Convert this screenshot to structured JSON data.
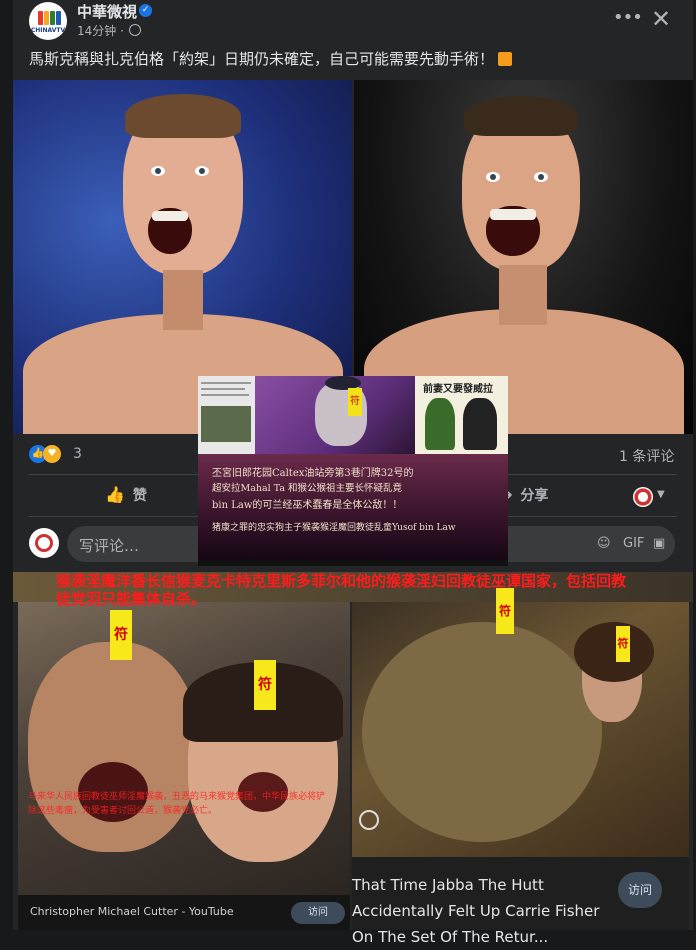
{
  "post": {
    "page_name": "中華微視",
    "avatar_brand": "CHINAVTV",
    "time": "14分钟 ·",
    "text": "馬斯克稱與扎克伯格「約架」日期仍未確定，自己可能需要先動手術！",
    "more_label": "•••",
    "close_label": "✕"
  },
  "stats": {
    "reaction_count": "3",
    "comments": "1 条评论"
  },
  "actions": {
    "like": "赞",
    "share": "分享"
  },
  "comment": {
    "placeholder": "写评论…"
  },
  "overlay": {
    "right_title": "前妻又要發威拉",
    "line1": "丕宮旧郎花园Caltex油站旁第3巷门牌32号的",
    "line2": "超安拉Mahal Ta 和猴公猴祖主要长怀疑乱竟",
    "line3": "bin Law的可兰经巫术蠢春是全体公敌！！",
    "line4": "猪康之罪的忠实狗主子猴袭猴淫魔回教徒乱童Yusof bin Law",
    "talisman": "符"
  },
  "meme": {
    "title": "猴袭淫魔洋番长信猴麦克卡特克里斯多菲尔和他的猴袭淫妇回教徒巫谭国家，包括回教徒党羽只能集体自杀。",
    "talisman": "符",
    "red_paragraph": "马来华人民族回教徒巫师淫魔猴袭，丑恶的马来猴党集团，中华民族必将铲除这些毒瘤，为受害者讨回公道，猴袭党必亡。",
    "left_caption": "Christopher Michael Cutter - YouTube",
    "left_visit": "访问",
    "right_caption": "That Time Jabba The Hutt Accidentally Felt Up Carrie Fisher On The Set Of The Retur...",
    "right_visit": "访问"
  },
  "colors": {
    "background": "#18191a",
    "card": "#242526",
    "text_primary": "#e4e6eb",
    "text_secondary": "#b0b3b8",
    "verified": "#1b74e4",
    "meme_red": "#ff1b1b"
  }
}
